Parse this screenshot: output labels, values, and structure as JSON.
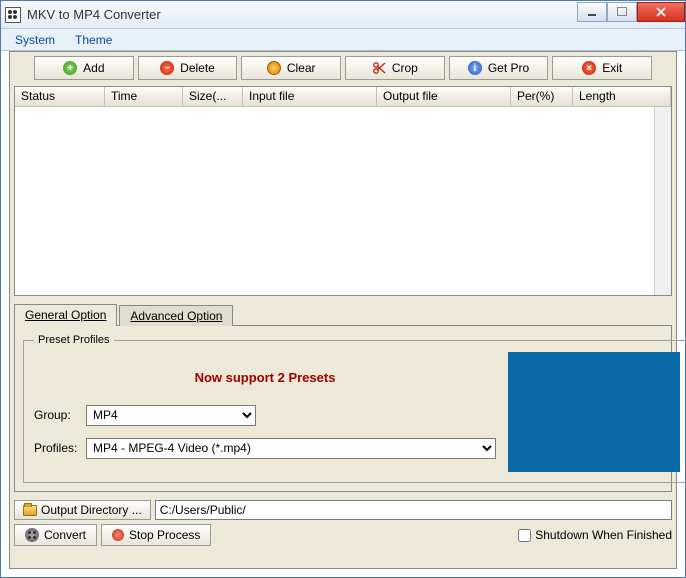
{
  "window": {
    "title": "MKV to MP4 Converter"
  },
  "menu": {
    "system": "System",
    "theme": "Theme"
  },
  "toolbar": {
    "add": "Add",
    "delete": "Delete",
    "clear": "Clear",
    "crop": "Crop",
    "getpro": "Get Pro",
    "exit": "Exit"
  },
  "columns": {
    "status": "Status",
    "time": "Time",
    "size": "Size(...",
    "input": "Input file",
    "output": "Output file",
    "per": "Per(%)",
    "length": "Length"
  },
  "tabs": {
    "general": "General Option",
    "advanced": "Advanced Option"
  },
  "preset": {
    "legend": "Preset Profiles",
    "banner": "Now support 2 Presets",
    "group_label": "Group:",
    "group_value": "MP4",
    "profiles_label": "Profiles:",
    "profiles_value": "MP4 - MPEG-4 Video (*.mp4)"
  },
  "output": {
    "button": "Output Directory ...",
    "path": "C:/Users/Public/"
  },
  "actions": {
    "convert": "Convert",
    "stop": "Stop Process",
    "shutdown": "Shutdown When Finished"
  }
}
